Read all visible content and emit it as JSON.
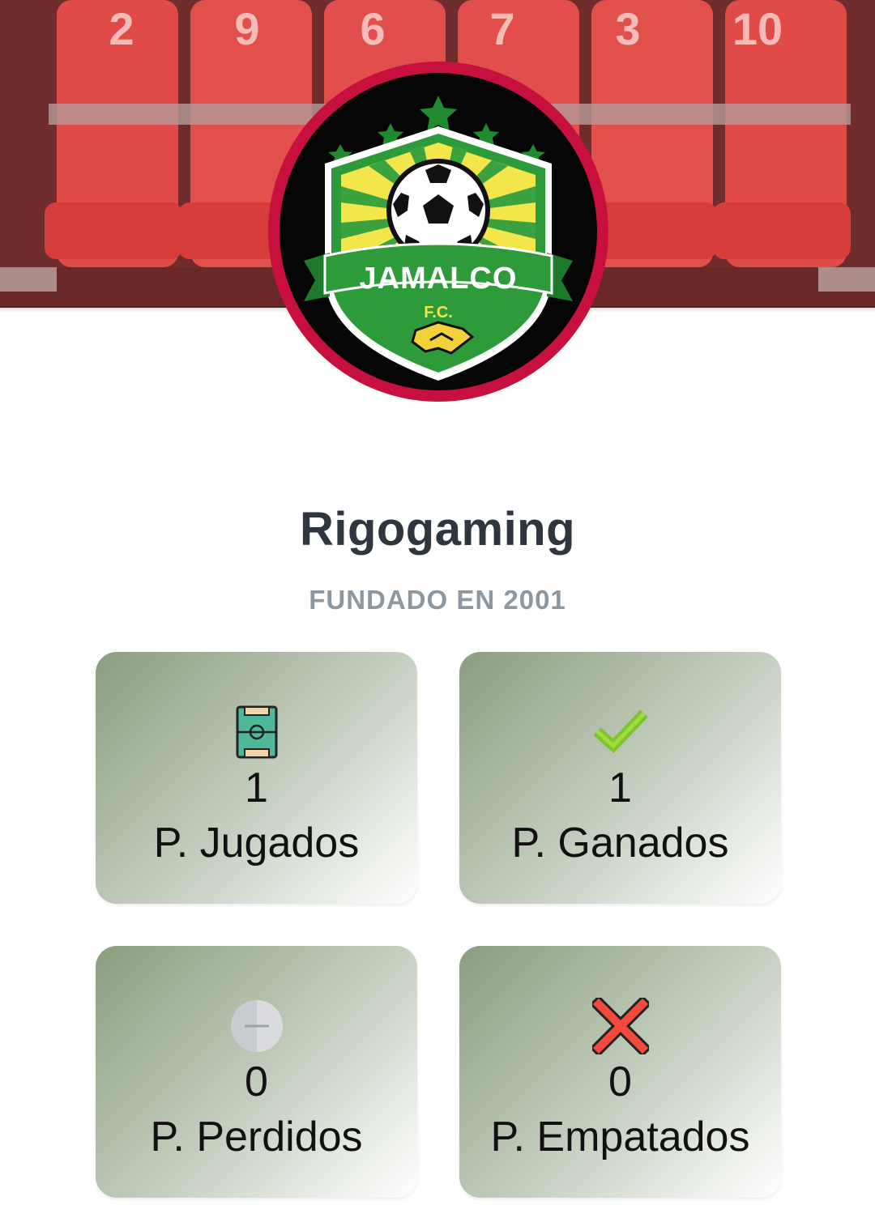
{
  "team": {
    "name": "Rigogaming",
    "founded": "FUNDADO EN 2001"
  },
  "crest": {
    "club_name": "JAMALCO",
    "club_suffix": "F.C."
  },
  "cover": {
    "shirt_numbers": [
      "2",
      "9",
      "6",
      "7",
      "3",
      "10"
    ]
  },
  "stats": [
    {
      "value": "1",
      "label": "P. Jugados",
      "icon": "soccer-field-icon"
    },
    {
      "value": "1",
      "label": "P. Ganados",
      "icon": "checkmark-icon"
    },
    {
      "value": "0",
      "label": "P. Perdidos",
      "icon": "minus-circle-icon"
    },
    {
      "value": "0",
      "label": "P. Empatados",
      "icon": "cross-icon"
    }
  ],
  "colors": {
    "crest_ring": "#c8103e",
    "title": "#2f3640",
    "subtitle": "#8d979f"
  }
}
